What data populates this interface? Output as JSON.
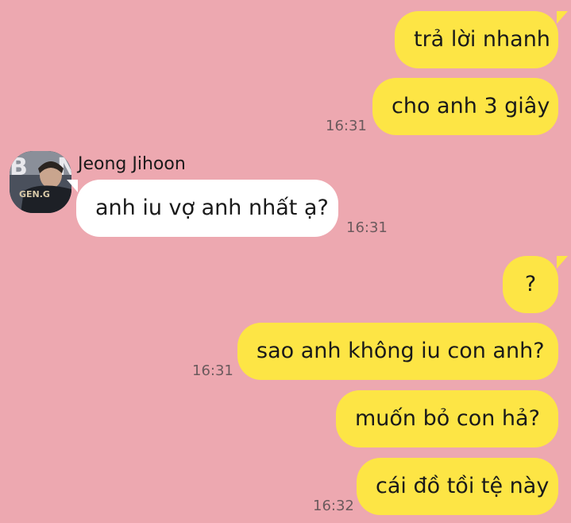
{
  "contact": {
    "name": "Jeong Jihoon",
    "avatar_text": "GEN.G"
  },
  "messages": [
    {
      "from": "me",
      "text": "trả lời nhanh"
    },
    {
      "from": "me",
      "text": "cho anh 3 giây",
      "time": "16:31"
    },
    {
      "from": "them",
      "text": "anh iu vợ anh nhất ạ?",
      "time": "16:31"
    },
    {
      "from": "me",
      "text": "?"
    },
    {
      "from": "me",
      "text": "sao anh không iu con anh?",
      "time": "16:31"
    },
    {
      "from": "me",
      "text": "muốn bỏ con hả?"
    },
    {
      "from": "me",
      "text": "cái đồ tồi tệ này",
      "time": "16:32"
    }
  ],
  "colors": {
    "background": "#eda8b0",
    "my_bubble": "#fde545",
    "their_bubble": "#ffffff"
  }
}
